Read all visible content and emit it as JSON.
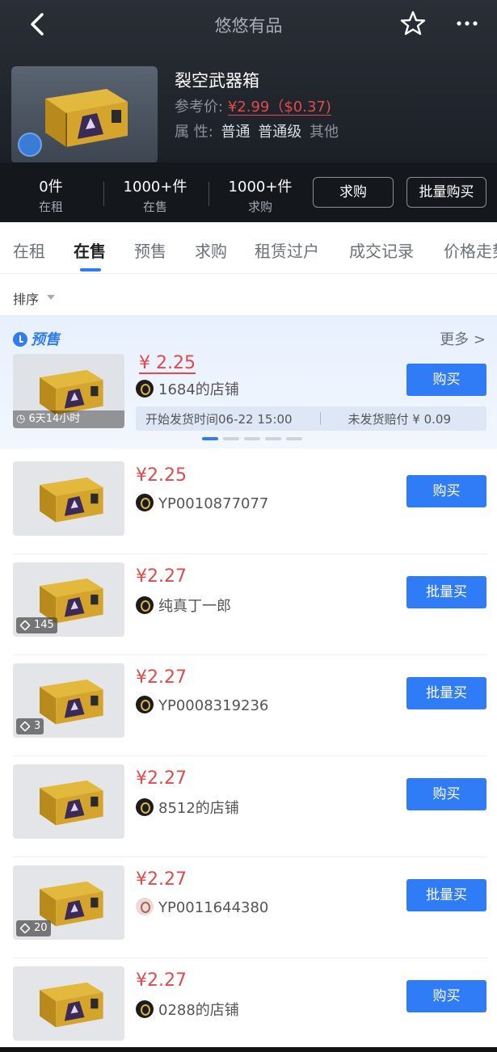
{
  "nav": {
    "title": "悠悠有品"
  },
  "item": {
    "name": "裂空武器箱",
    "ref_label": "参考价:",
    "ref_price": "¥2.99（$0.37)",
    "attr_label": "属 性:",
    "attrs": [
      "普通",
      "普通级",
      "其他"
    ]
  },
  "stats": [
    {
      "count": "0件",
      "label": "在租"
    },
    {
      "count": "1000+件",
      "label": "在售"
    },
    {
      "count": "1000+件",
      "label": "求购"
    }
  ],
  "actions": {
    "want": "求购",
    "bulk": "批量购买"
  },
  "tabs": [
    "在租",
    "在售",
    "预售",
    "求购",
    "租赁过户",
    "成交记录",
    "价格走势"
  ],
  "active_tab": "在售",
  "sort": {
    "label": "排序"
  },
  "presale": {
    "title": "预售",
    "more": "更多 >",
    "timer": "6天14小时",
    "price": "¥ 2.25",
    "seller": "1684的店铺",
    "ship_time": "开始发货时间06-22 15:00",
    "compensation": "未发货赔付 ¥ 0.09",
    "buy_label": "购买"
  },
  "listings": [
    {
      "price": "¥2.25",
      "seller": "YP0010877077",
      "stack": "",
      "button": "购买",
      "avatar": "gold"
    },
    {
      "price": "¥2.27",
      "seller": "纯真丁一郎",
      "stack": "145",
      "button": "批量买",
      "avatar": "gold"
    },
    {
      "price": "¥2.27",
      "seller": "YP0008319236",
      "stack": "3",
      "button": "批量买",
      "avatar": "gold"
    },
    {
      "price": "¥2.27",
      "seller": "8512的店铺",
      "stack": "",
      "button": "购买",
      "avatar": "gold"
    },
    {
      "price": "¥2.27",
      "seller": "YP0011644380",
      "stack": "20",
      "button": "批量买",
      "avatar": "pink"
    },
    {
      "price": "¥2.27",
      "seller": "0288的店铺",
      "stack": "",
      "button": "购买",
      "avatar": "gold"
    }
  ],
  "colors": {
    "accent": "#2f7cf6",
    "price": "#e24b4b",
    "header_bg": "#1e232a"
  }
}
